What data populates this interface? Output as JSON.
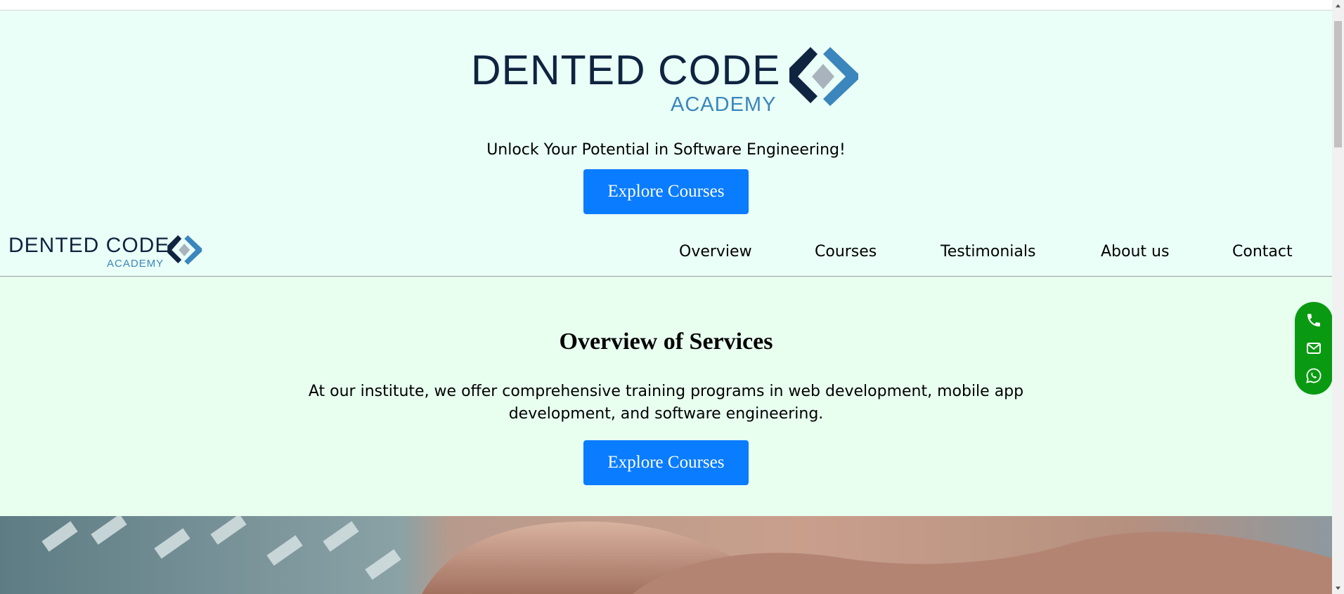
{
  "brand": {
    "name": "DENTED CODE",
    "sub": "ACADEMY",
    "colors": {
      "dark": "#0f2440",
      "blue": "#3a86bd",
      "gray": "#a9b3bd"
    }
  },
  "hero": {
    "tagline": "Unlock Your Potential in Software Engineering!",
    "cta_label": "Explore Courses"
  },
  "nav": {
    "items": [
      {
        "label": "Overview"
      },
      {
        "label": "Courses"
      },
      {
        "label": "Testimonials"
      },
      {
        "label": "About us"
      },
      {
        "label": "Contact"
      }
    ]
  },
  "overview": {
    "title": "Overview of Services",
    "text": "At our institute, we offer comprehensive training programs in web development, mobile app development, and software engineering.",
    "cta_label": "Explore Courses"
  },
  "contact_widget": {
    "icons": [
      "phone-icon",
      "mail-icon",
      "whatsapp-icon"
    ],
    "color": "#0a9a12"
  },
  "colors": {
    "hero_bg": "#eafff7",
    "overview_bg": "#e8fff0",
    "button": "#0a7cff"
  }
}
